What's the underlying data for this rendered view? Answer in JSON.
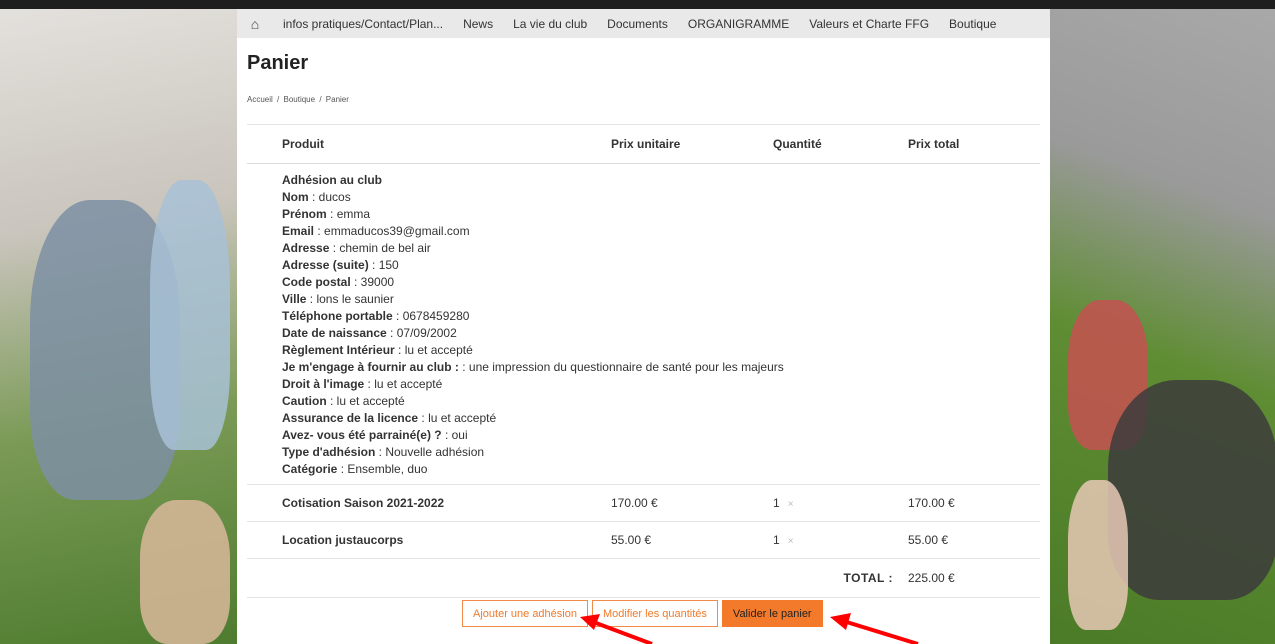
{
  "nav": {
    "items": [
      "infos pratiques/Contact/Plan...",
      "News",
      "La vie du club",
      "Documents",
      "ORGANIGRAMME",
      "Valeurs et Charte FFG",
      "Boutique"
    ]
  },
  "page": {
    "title": "Panier",
    "breadcrumb": [
      "Accueil",
      "/",
      "Boutique",
      "/",
      "Panier"
    ]
  },
  "cart": {
    "headers": [
      "Produit",
      "Prix unitaire",
      "Quantité",
      "Prix total"
    ],
    "membership": {
      "title": "Adhésion au club",
      "fields": [
        {
          "label": "Nom",
          "value": " : ducos"
        },
        {
          "label": "Prénom",
          "value": " : emma"
        },
        {
          "label": "Email",
          "value": " : emmaducos39@gmail.com"
        },
        {
          "label": "Adresse",
          "value": " : chemin de bel air"
        },
        {
          "label": "Adresse (suite)",
          "value": " : 150"
        },
        {
          "label": "Code postal",
          "value": " : 39000"
        },
        {
          "label": "Ville",
          "value": " : lons le saunier"
        },
        {
          "label": "Téléphone portable",
          "value": " : 0678459280"
        },
        {
          "label": "Date de naissance",
          "value": " : 07/09/2002"
        },
        {
          "label": "Règlement Intérieur",
          "value": " : lu et accepté"
        },
        {
          "label": "Je m'engage à fournir au club :",
          "value": " : une impression du questionnaire de santé pour les majeurs"
        },
        {
          "label": "Droit à l'image",
          "value": " : lu et accepté"
        },
        {
          "label": "Caution",
          "value": " : lu et accepté"
        },
        {
          "label": "Assurance de la licence",
          "value": " : lu et accepté"
        },
        {
          "label": "Avez- vous été parrainé(e) ?",
          "value": " : oui"
        },
        {
          "label": "Type d'adhésion",
          "value": " : Nouvelle adhésion"
        },
        {
          "label": "Catégorie",
          "value": " : Ensemble, duo"
        }
      ]
    },
    "rows": [
      {
        "name": "Cotisation Saison 2021-2022",
        "unit": "170.00 €",
        "qty": "1",
        "remove": "×",
        "total": "170.00 €"
      },
      {
        "name": "Location justaucorps",
        "unit": "55.00 €",
        "qty": "1",
        "remove": "×",
        "total": "55.00 €"
      }
    ],
    "total_label": "TOTAL :",
    "total_value": "225.00 €"
  },
  "buttons": {
    "add": "Ajouter une adhésion",
    "modify": "Modifier les quantités",
    "validate": "Valider le panier"
  },
  "colors": {
    "accent": "#f47a2b",
    "annotation_arrow": "#ff0000"
  }
}
